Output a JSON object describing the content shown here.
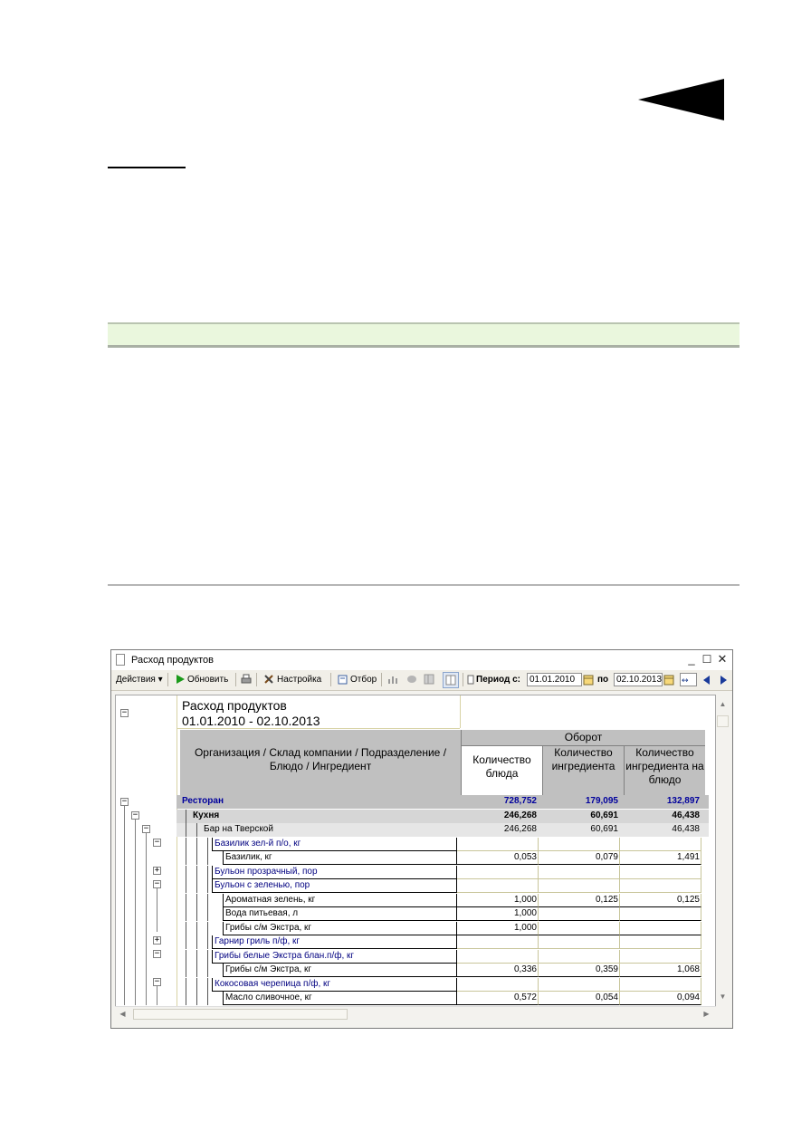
{
  "window": {
    "title": "Расход продуктов",
    "toolbar": {
      "actions_label": "Действия",
      "refresh_label": "Обновить",
      "settings_label": "Настройка",
      "filter_label": "Отбор",
      "period_from_label": "Период с:",
      "period_from_value": "01.01.2010",
      "period_to_label": "по",
      "period_to_value": "02.10.2013"
    }
  },
  "report": {
    "title": "Расход продуктов",
    "period": "01.01.2010 - 02.10.2013",
    "header": {
      "group_label": "Организация / Склад компании / Подразделение / Блюдо / Ингредиент",
      "turnover_label": "Оборот",
      "col_dish_qty": "Количество блюда",
      "col_ingredient_qty": "Количество ингредиента",
      "col_ingredient_per_dish": "Количество ингредиента на блюдо"
    },
    "rows": [
      {
        "label": "Ресторан",
        "qty_dish": "728,752",
        "qty_ingr": "179,095",
        "qty_per": "132,897"
      },
      {
        "label": "Кухня",
        "qty_dish": "246,268",
        "qty_ingr": "60,691",
        "qty_per": "46,438"
      },
      {
        "label": "Бар на Тверской",
        "qty_dish": "246,268",
        "qty_ingr": "60,691",
        "qty_per": "46,438"
      },
      {
        "label": "Базилик зел-й п/о, кг",
        "qty_dish": "",
        "qty_ingr": "",
        "qty_per": ""
      },
      {
        "label": "Базилик, кг",
        "qty_dish": "0,053",
        "qty_ingr": "0,079",
        "qty_per": "1,491"
      },
      {
        "label": "Бульон прозрачный, пор",
        "qty_dish": "",
        "qty_ingr": "",
        "qty_per": ""
      },
      {
        "label": "Бульон с зеленью, пор",
        "qty_dish": "",
        "qty_ingr": "",
        "qty_per": ""
      },
      {
        "label": "Ароматная зелень, кг",
        "qty_dish": "1,000",
        "qty_ingr": "0,125",
        "qty_per": "0,125"
      },
      {
        "label": "Вода питьевая, л",
        "qty_dish": "1,000",
        "qty_ingr": "",
        "qty_per": ""
      },
      {
        "label": "Грибы с/м Экстра, кг",
        "qty_dish": "1,000",
        "qty_ingr": "",
        "qty_per": ""
      },
      {
        "label": "Гарнир гриль п/ф, кг",
        "qty_dish": "",
        "qty_ingr": "",
        "qty_per": ""
      },
      {
        "label": "Грибы белые Экстра блан.п/ф, кг",
        "qty_dish": "",
        "qty_ingr": "",
        "qty_per": ""
      },
      {
        "label": "Грибы с/м Экстра, кг",
        "qty_dish": "0,336",
        "qty_ingr": "0,359",
        "qty_per": "1,068"
      },
      {
        "label": "Кокосовая черепица п/ф, кг",
        "qty_dish": "",
        "qty_ingr": "",
        "qty_per": ""
      },
      {
        "label": "Масло сливочное, кг",
        "qty_dish": "0,572",
        "qty_ingr": "0,054",
        "qty_per": "0,094"
      }
    ]
  },
  "colors": {
    "green_band": "#eaf7dd",
    "header_gray": "#c0c0c0",
    "level0_text": "#00009c",
    "level_item_text": "#000080"
  }
}
